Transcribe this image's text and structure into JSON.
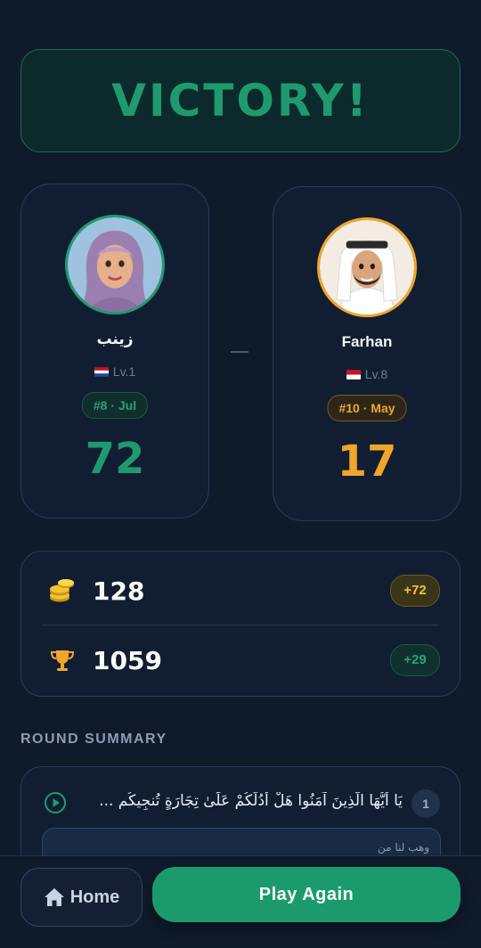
{
  "banner": {
    "title": "VICTORY!"
  },
  "players": [
    {
      "name": "زينب",
      "level": "Lv.1",
      "flag_icon": "netherlands-flag-icon",
      "rank": "#8 · Jul",
      "score": "72",
      "accent": "#1f9a6e"
    },
    {
      "name": "Farhan",
      "level": "Lv.8",
      "flag_icon": "indonesia-flag-icon",
      "rank": "#10 · May",
      "score": "17",
      "accent": "#f0a62a"
    }
  ],
  "stats": [
    {
      "icon": "coins-icon",
      "value": "128",
      "delta": "+72"
    },
    {
      "icon": "trophy-icon",
      "value": "1059",
      "delta": "+29"
    }
  ],
  "round_summary": {
    "title": "ROUND SUMMARY",
    "rounds": [
      {
        "number": "1",
        "verse": "يَا أَيُّهَا الَّذِينَ آمَنُوا هَلْ أَدُلُّكُمْ عَلَىٰ تِجَارَةٍ تُنجِيكُم ...",
        "answer_preview": "وهب لنا من"
      }
    ]
  },
  "footer": {
    "home_label": "Home",
    "play_again_label": "Play Again"
  },
  "colors": {
    "background": "#0f1a2b",
    "win_green": "#1f9a6e",
    "opponent_orange": "#f0a62a",
    "coin_gold": "#f4c430"
  }
}
